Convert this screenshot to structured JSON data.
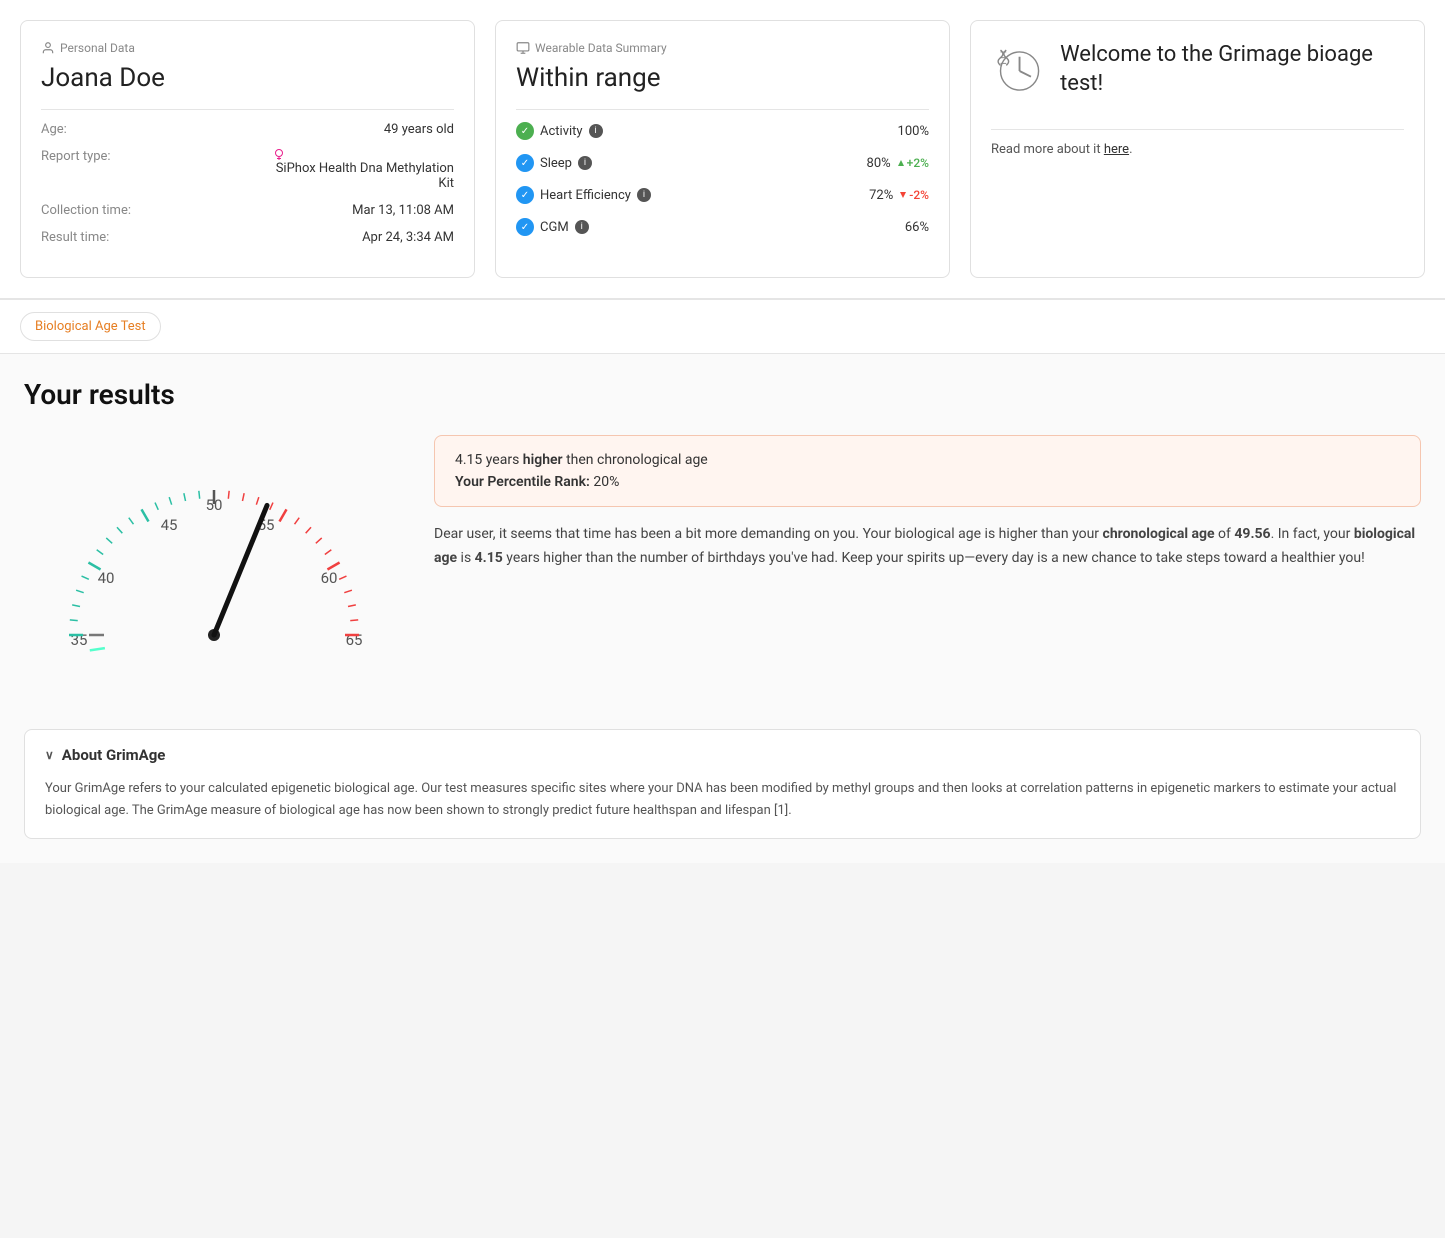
{
  "personal_data": {
    "section_label": "Personal Data",
    "name": "Joana Doe",
    "age_label": "Age:",
    "age_value": "49 years old",
    "report_label": "Report type:",
    "report_value": "SiPhox Health Dna Methylation Kit",
    "collection_label": "Collection time:",
    "collection_value": "Mar 13, 11:08 AM",
    "result_label": "Result time:",
    "result_value": "Apr 24, 3:34 AM"
  },
  "wearable_data": {
    "section_label": "Wearable Data Summary",
    "status": "Within range",
    "metrics": [
      {
        "name": "Activity",
        "check_type": "green",
        "value": "100%",
        "badge": null,
        "badge_type": null
      },
      {
        "name": "Sleep",
        "check_type": "blue",
        "value": "80%",
        "badge": "+2%",
        "badge_type": "green"
      },
      {
        "name": "Heart Efficiency",
        "check_type": "blue",
        "value": "72%",
        "badge": "-2%",
        "badge_type": "red"
      },
      {
        "name": "CGM",
        "check_type": "blue",
        "value": "66%",
        "badge": null,
        "badge_type": null
      }
    ]
  },
  "welcome": {
    "title": "Welcome to the Grimage bioage test!",
    "divider": true,
    "body": "Read more about it",
    "link_text": "here",
    "link_suffix": "."
  },
  "tab_bar": {
    "active_tab": "Biological Age Test"
  },
  "results": {
    "title": "Your results",
    "gauge": {
      "min": 35,
      "max": 65,
      "pointer_value": 53.15,
      "labels": [
        "35",
        "40",
        "45",
        "50",
        "55",
        "60",
        "65"
      ]
    },
    "alert": {
      "years_diff": "4.15",
      "direction": "higher",
      "comparison": "then chronological age",
      "percentile_label": "Your Percentile Rank:",
      "percentile_value": "20%"
    },
    "description": "Dear user, it seems that time has been a bit more demanding on you. Your biological age is higher than your chronological age of 49.56. In fact, your biological age is 4.15 years higher than the number of birthdays you've had. Keep your spirits up—every day is a new chance to take steps toward a healthier you!",
    "description_bold_phrases": [
      "chronological age",
      "49.56",
      "biological age",
      "4.15"
    ]
  },
  "about": {
    "header": "About GrimAge",
    "chevron": "∨",
    "body": "Your GrimAge refers to your calculated epigenetic biological age. Our test measures specific sites where your DNA has been modified by methyl groups and then looks at correlation patterns in epigenetic markers to estimate your actual biological age. The GrimAge measure of biological age has now been shown to strongly predict future healthspan and lifespan [1]."
  },
  "icons": {
    "person": "person-icon",
    "chart": "chart-icon",
    "dna_clock": "dna-clock-icon",
    "info": "info-icon",
    "checkmark": "✓"
  }
}
